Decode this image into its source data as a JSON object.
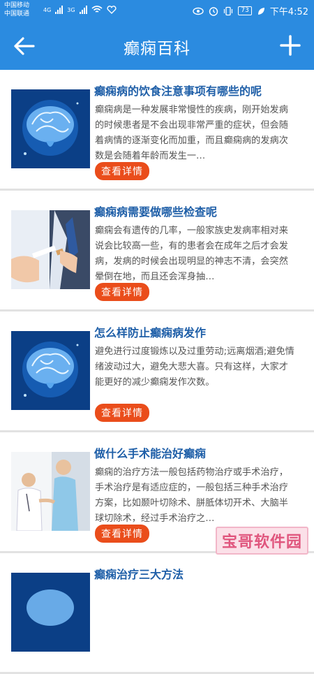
{
  "status_bar": {
    "carrier_1": "中国移动",
    "carrier_2": "中国联通",
    "net_1": "4G",
    "net_2": "3G",
    "battery": "73",
    "time": "下午4:52"
  },
  "appbar": {
    "title": "癫痫百科",
    "back_icon": "arrow-left-icon",
    "add_icon": "plus-icon"
  },
  "articles": [
    {
      "title": "癫痫病的饮食注意事项有哪些的呢",
      "summary": "癫痫病是一种发展非常慢性的疾病，刚开始发病的时候患者是不会出现非常严重的症状，但会随着病情的逐渐变化而加重，而且癫痫病的发病次数是会随着年龄而发生一…",
      "button": "查看详情",
      "image": "brain-image"
    },
    {
      "title": "癫痫病需要做哪些检查呢",
      "summary": "癫痫会有遗传的几率，一般家族史发病率相对来说会比较高一些，有的患者会在成年之后才会发病，发病的时候会出现明显的神志不清，会突然晕倒在地，而且还会浑身抽…",
      "button": "查看详情",
      "image": "broken-cigarette-image"
    },
    {
      "title": "怎么样防止癫痫病发作",
      "summary": "避免进行过度锻炼以及过重劳动;远离烟酒;避免情绪波动过大，避免大悲大喜。只有这样，大家才能更好的减少癫痫发作次数。",
      "button": "查看详情",
      "image": "brain-image"
    },
    {
      "title": "做什么手术能治好癫痫",
      "summary": "癫痫的治疗方法一般包括药物治疗或手术治疗，手术治疗是有适应症的，一般包括三种手术治疗方案，比如颞叶切除术、胼胝体切开术、大脑半球切除术，经过手术治疗之…",
      "button": "查看详情",
      "image": "doctor-patient-image"
    },
    {
      "title": "癫痫治疗三大方法",
      "summary": "",
      "button": "",
      "image": "brain-image"
    }
  ],
  "watermark": "宝哥软件园",
  "colors": {
    "primary": "#2b8be0",
    "title_blue": "#1f5fa8",
    "button_orange": "#ea4d1b"
  }
}
